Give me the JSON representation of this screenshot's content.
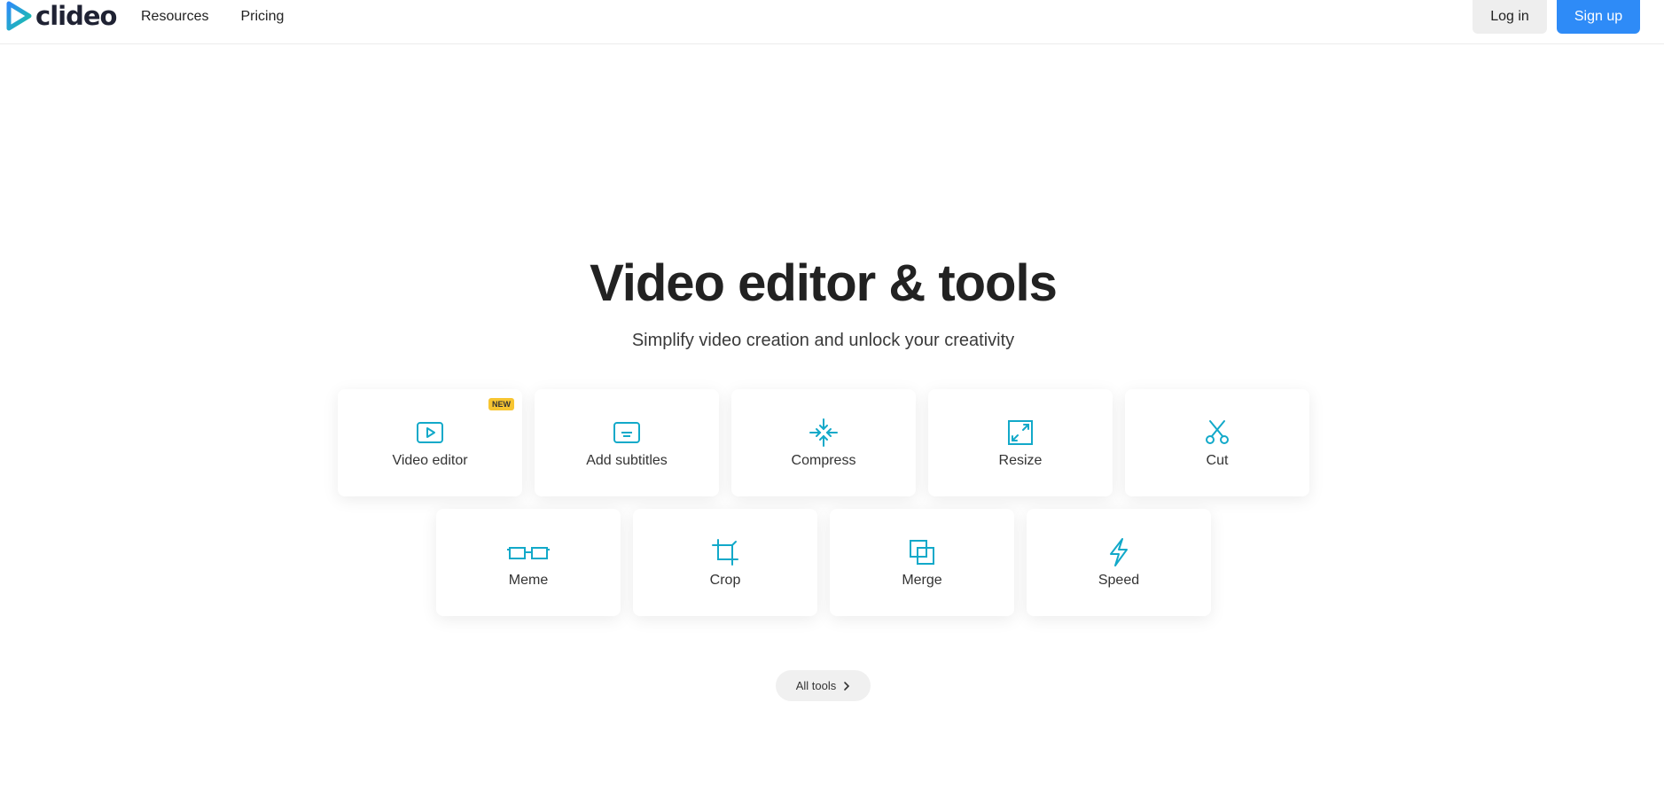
{
  "header": {
    "logo_text": "clideo",
    "nav": [
      {
        "label": "Resources"
      },
      {
        "label": "Pricing"
      }
    ],
    "login_label": "Log in",
    "signup_label": "Sign up"
  },
  "hero": {
    "title": "Video editor & tools",
    "subtitle": "Simplify video creation and unlock your creativity"
  },
  "tools": [
    {
      "label": "Video editor",
      "icon": "play-icon",
      "badge": "NEW"
    },
    {
      "label": "Add subtitles",
      "icon": "subtitles-icon"
    },
    {
      "label": "Compress",
      "icon": "compress-icon"
    },
    {
      "label": "Resize",
      "icon": "resize-icon"
    },
    {
      "label": "Cut",
      "icon": "scissors-icon"
    },
    {
      "label": "Meme",
      "icon": "meme-icon"
    },
    {
      "label": "Crop",
      "icon": "crop-icon"
    },
    {
      "label": "Merge",
      "icon": "merge-icon"
    },
    {
      "label": "Speed",
      "icon": "lightning-icon"
    }
  ],
  "all_tools_label": "All tools",
  "colors": {
    "accent": "#2e8bf7",
    "icon": "#12a9c9",
    "badge": "#f7c531"
  }
}
